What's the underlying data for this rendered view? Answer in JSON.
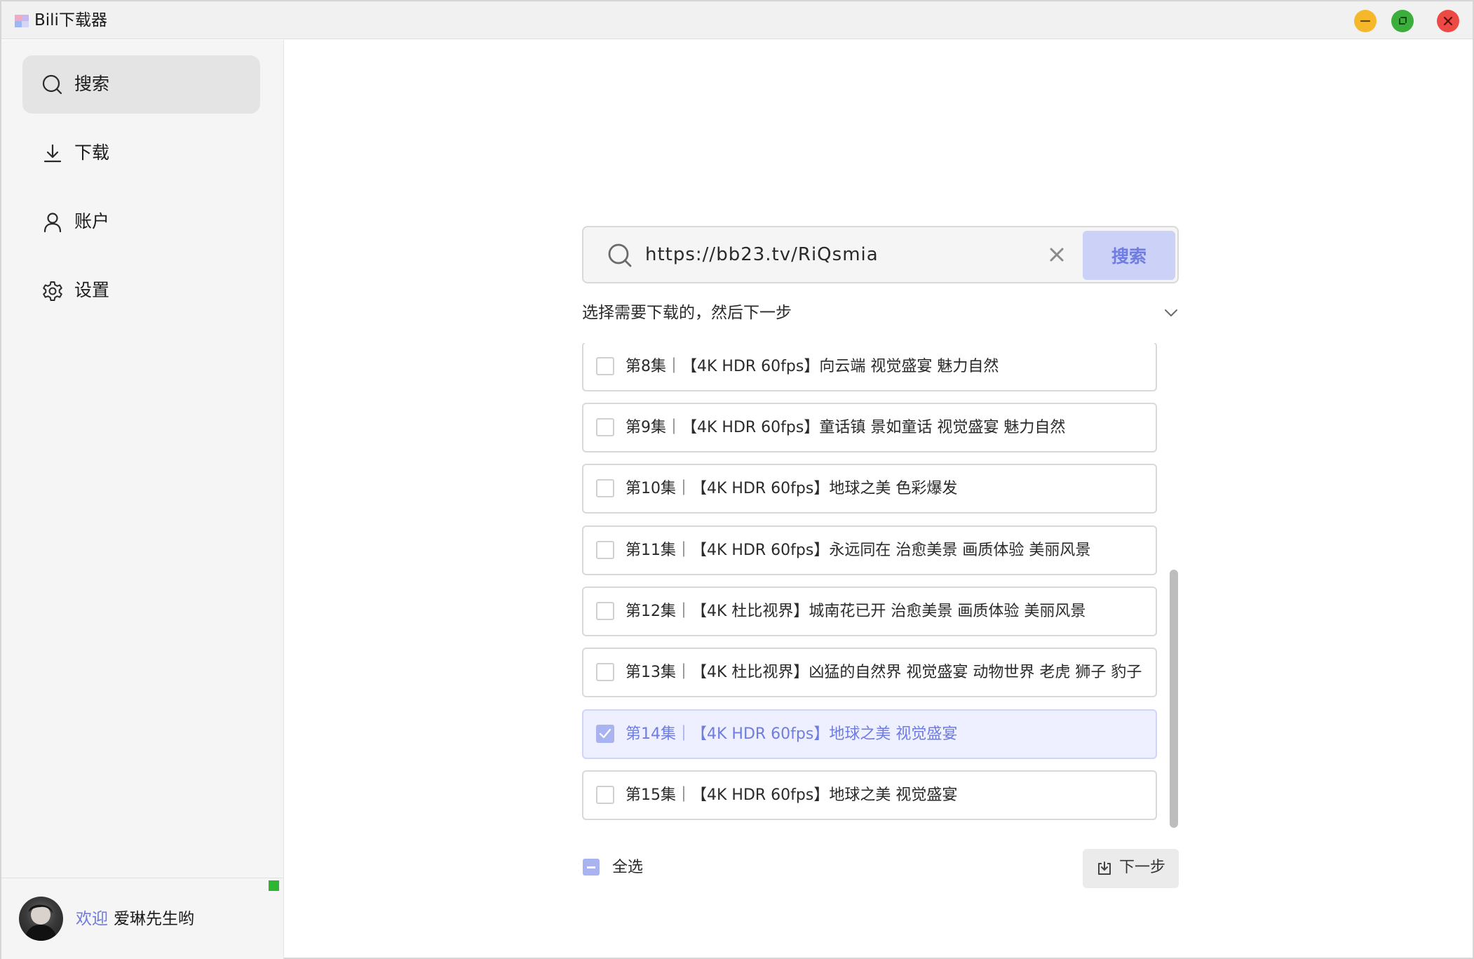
{
  "window": {
    "title": "Bili下载器",
    "controls": [
      "minimize",
      "maximize",
      "close"
    ],
    "colors": {
      "minimize": "#f5b82a",
      "maximize": "#3cae3c",
      "close": "#ee4a45"
    }
  },
  "sidebar": {
    "items": [
      {
        "label": "搜索",
        "icon": "search-icon",
        "active": true
      },
      {
        "label": "下载",
        "icon": "download-icon",
        "active": false
      },
      {
        "label": "账户",
        "icon": "user-icon",
        "active": false
      },
      {
        "label": "设置",
        "icon": "gear-icon",
        "active": false
      }
    ],
    "user": {
      "welcome": "欢迎",
      "name": "爱琳先生哟",
      "status_color": "#2fb52f"
    }
  },
  "search": {
    "value": "https://bb23.tv/RiQsmia",
    "button_label": "搜索"
  },
  "results": {
    "hint": "选择需要下载的，然后下一步",
    "items": [
      {
        "label": "第8集｜【4K HDR 60fps】向云端 视觉盛宴 魅力自然",
        "checked": false
      },
      {
        "label": "第9集｜【4K HDR 60fps】童话镇 景如童话 视觉盛宴 魅力自然",
        "checked": false
      },
      {
        "label": "第10集｜【4K HDR 60fps】地球之美 色彩爆发",
        "checked": false
      },
      {
        "label": "第11集｜【4K HDR 60fps】永远同在 治愈美景 画质体验 美丽风景",
        "checked": false
      },
      {
        "label": "第12集｜【4K 杜比视界】城南花已开 治愈美景 画质体验 美丽风景",
        "checked": false
      },
      {
        "label": "第13集｜【4K 杜比视界】凶猛的自然界 视觉盛宴 动物世界 老虎 狮子 豹子",
        "checked": false
      },
      {
        "label": "第14集｜【4K HDR 60fps】地球之美 视觉盛宴",
        "checked": true
      },
      {
        "label": "第15集｜【4K HDR 60fps】地球之美 视觉盛宴",
        "checked": false
      }
    ],
    "select_all_label": "全选",
    "next_button_label": "下一步"
  },
  "theme": {
    "accent": "#6f7ce0",
    "accent_light": "#cbd1f7",
    "selected_bg": "#eef0ff"
  }
}
